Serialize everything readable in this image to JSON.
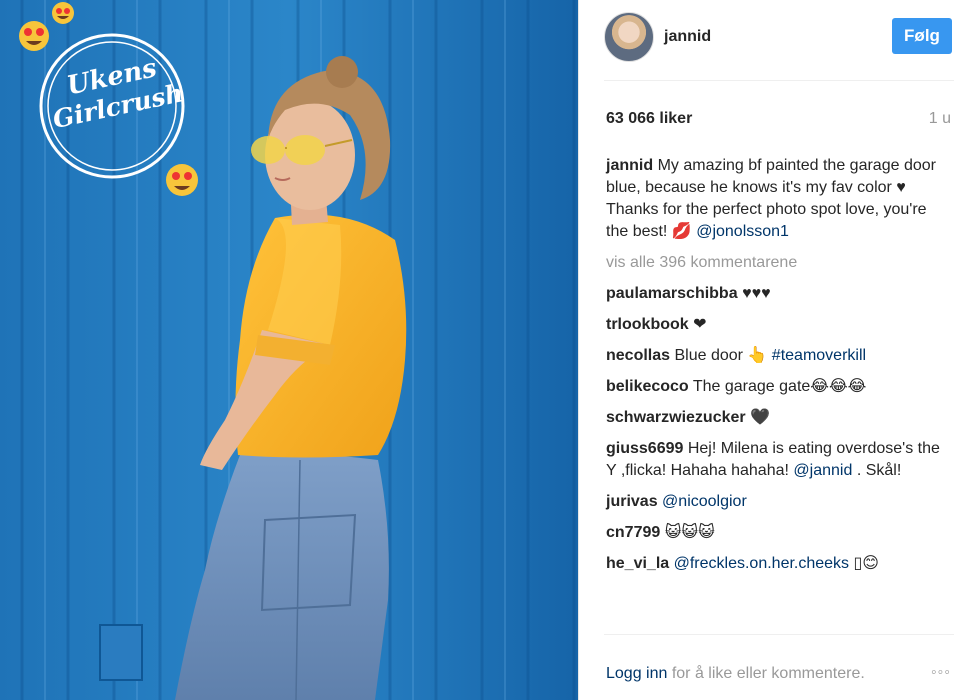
{
  "photo": {
    "badge_line1": "Ukens",
    "badge_line2": "Girlcrush"
  },
  "post": {
    "username": "jannid",
    "follow_label": "Følg",
    "likes": "63 066 liker",
    "time": "1 u",
    "caption": {
      "user": "jannid",
      "text": "My amazing bf painted the garage door blue, because he knows it's my fav color ♥ Thanks for the perfect photo spot love, you're the best! 💋",
      "mention": "@jonolsson1"
    },
    "view_all": "vis alle 396 kommentarene",
    "comments": [
      {
        "user": "paulamarschibba",
        "text": "♥♥♥",
        "mention": ""
      },
      {
        "user": "trlookbook",
        "text": "❤",
        "mention": ""
      },
      {
        "user": "necollas",
        "text": "Blue door 👆",
        "mention": "#teamoverkill"
      },
      {
        "user": "belikecoco",
        "text": "The garage gate😂😂😂",
        "mention": ""
      },
      {
        "user": "schwarzwiezucker",
        "text": "🖤",
        "mention": ""
      },
      {
        "user": "giuss6699",
        "text": "Hej! Milena is eating overdose's the Y ,flicka! Hahaha hahaha!",
        "mention": "@jannid",
        "suffix": ". Skål!"
      },
      {
        "user": "jurivas",
        "text": "",
        "mention": "@nicoolgior"
      },
      {
        "user": "cn7799",
        "text": "😺😺😺",
        "mention": ""
      },
      {
        "user": "he_vi_la",
        "text": "",
        "mention": "@freckles.on.her.cheeks",
        "suffix": "▯😊"
      }
    ],
    "footer_login": "Logg inn",
    "footer_text": " for å like eller kommentere.",
    "more": "◦◦◦"
  }
}
